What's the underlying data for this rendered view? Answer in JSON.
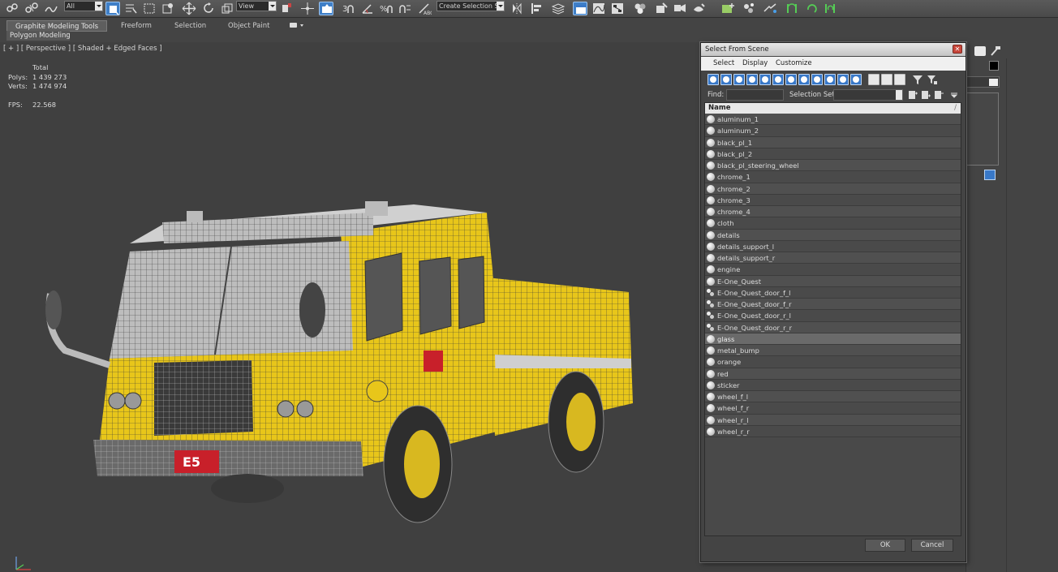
{
  "toolbar": {
    "selection_filter": "All",
    "reference_coord": "View",
    "named_selection_set": "Create Selection Se"
  },
  "ribbon": {
    "tabs": [
      "Graphite Modeling Tools",
      "Freeform",
      "Selection",
      "Object Paint"
    ],
    "active_tab": "Graphite Modeling Tools",
    "panel_label": "Polygon Modeling"
  },
  "viewport": {
    "label": "[ + ] [ Perspective ] [ Shaded + Edged Faces ]",
    "stats": {
      "total_label": "Total",
      "polys_label": "Polys:",
      "polys_value": "1 439 273",
      "verts_label": "Verts:",
      "verts_value": "1 474 974",
      "fps_label": "FPS:",
      "fps_value": "22.568"
    },
    "truck_numbers": "E5"
  },
  "dialog": {
    "title": "Select From Scene",
    "close_glyph": "✕",
    "menu": [
      "Select",
      "Display",
      "Customize"
    ],
    "find_label": "Find:",
    "selection_set_label": "Selection Set:",
    "list_header": "Name",
    "ok_label": "OK",
    "cancel_label": "Cancel",
    "items": [
      {
        "name": "aluminum_1",
        "icon": "object-icon"
      },
      {
        "name": "aluminum_2",
        "icon": "object-icon"
      },
      {
        "name": "black_pl_1",
        "icon": "object-icon"
      },
      {
        "name": "black_pl_2",
        "icon": "object-icon"
      },
      {
        "name": "black_pl_steering_wheel",
        "icon": "object-icon"
      },
      {
        "name": "chrome_1",
        "icon": "object-icon"
      },
      {
        "name": "chrome_2",
        "icon": "object-icon"
      },
      {
        "name": "chrome_3",
        "icon": "object-icon"
      },
      {
        "name": "chrome_4",
        "icon": "object-icon"
      },
      {
        "name": "cloth",
        "icon": "object-icon"
      },
      {
        "name": "details",
        "icon": "object-icon"
      },
      {
        "name": "details_support_l",
        "icon": "object-icon"
      },
      {
        "name": "details_support_r",
        "icon": "object-icon"
      },
      {
        "name": "engine",
        "icon": "object-icon"
      },
      {
        "name": "E-One_Quest",
        "icon": "object-icon"
      },
      {
        "name": "E-One_Quest_door_f_l",
        "icon": "group-icon"
      },
      {
        "name": "E-One_Quest_door_f_r",
        "icon": "group-icon"
      },
      {
        "name": "E-One_Quest_door_r_l",
        "icon": "group-icon"
      },
      {
        "name": "E-One_Quest_door_r_r",
        "icon": "group-icon"
      },
      {
        "name": "glass",
        "icon": "object-icon",
        "selected": true
      },
      {
        "name": "metal_bump",
        "icon": "object-icon"
      },
      {
        "name": "orange",
        "icon": "object-icon"
      },
      {
        "name": "red",
        "icon": "object-icon"
      },
      {
        "name": "sticker",
        "icon": "object-icon"
      },
      {
        "name": "wheel_f_l",
        "icon": "object-icon"
      },
      {
        "name": "wheel_f_r",
        "icon": "object-icon"
      },
      {
        "name": "wheel_r_l",
        "icon": "object-icon"
      },
      {
        "name": "wheel_r_r",
        "icon": "object-icon"
      }
    ]
  },
  "colors": {
    "stats_yellow": "#e7d84a",
    "truck_yellow": "#e8c61a",
    "active_blue": "#3878c8"
  }
}
